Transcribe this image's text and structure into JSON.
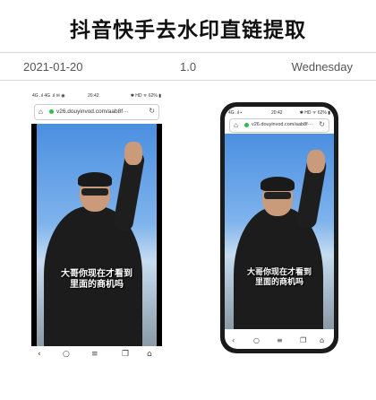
{
  "header": {
    "title": "抖音快手去水印直链提取"
  },
  "meta": {
    "date": "2021-01-20",
    "version": "1.0",
    "weekday": "Wednesday"
  },
  "screenshot": {
    "status_left": "4G .ıl 4G .ıl ✉ ◉",
    "status_time": "20:42",
    "status_right": "✱ HD ᯤ 62% ▮",
    "url": "v26.douyinvod.com/aab8f···",
    "caption_line1": "大哥你现在才看到",
    "caption_line2": "里面的商机吗"
  },
  "phone": {
    "status_left": "4G .ıl ▪",
    "status_time": "20:42",
    "status_right": "✱ HD ᯤ 62% ▮",
    "url": "v26.douyinvod.com/aab8f···",
    "caption_line1": "大哥你现在才看到",
    "caption_line2": "里面的商机吗"
  },
  "navbar": {
    "back": "‹",
    "search": "○",
    "menu": "≡",
    "tabs": "❐",
    "home": "⌂"
  }
}
